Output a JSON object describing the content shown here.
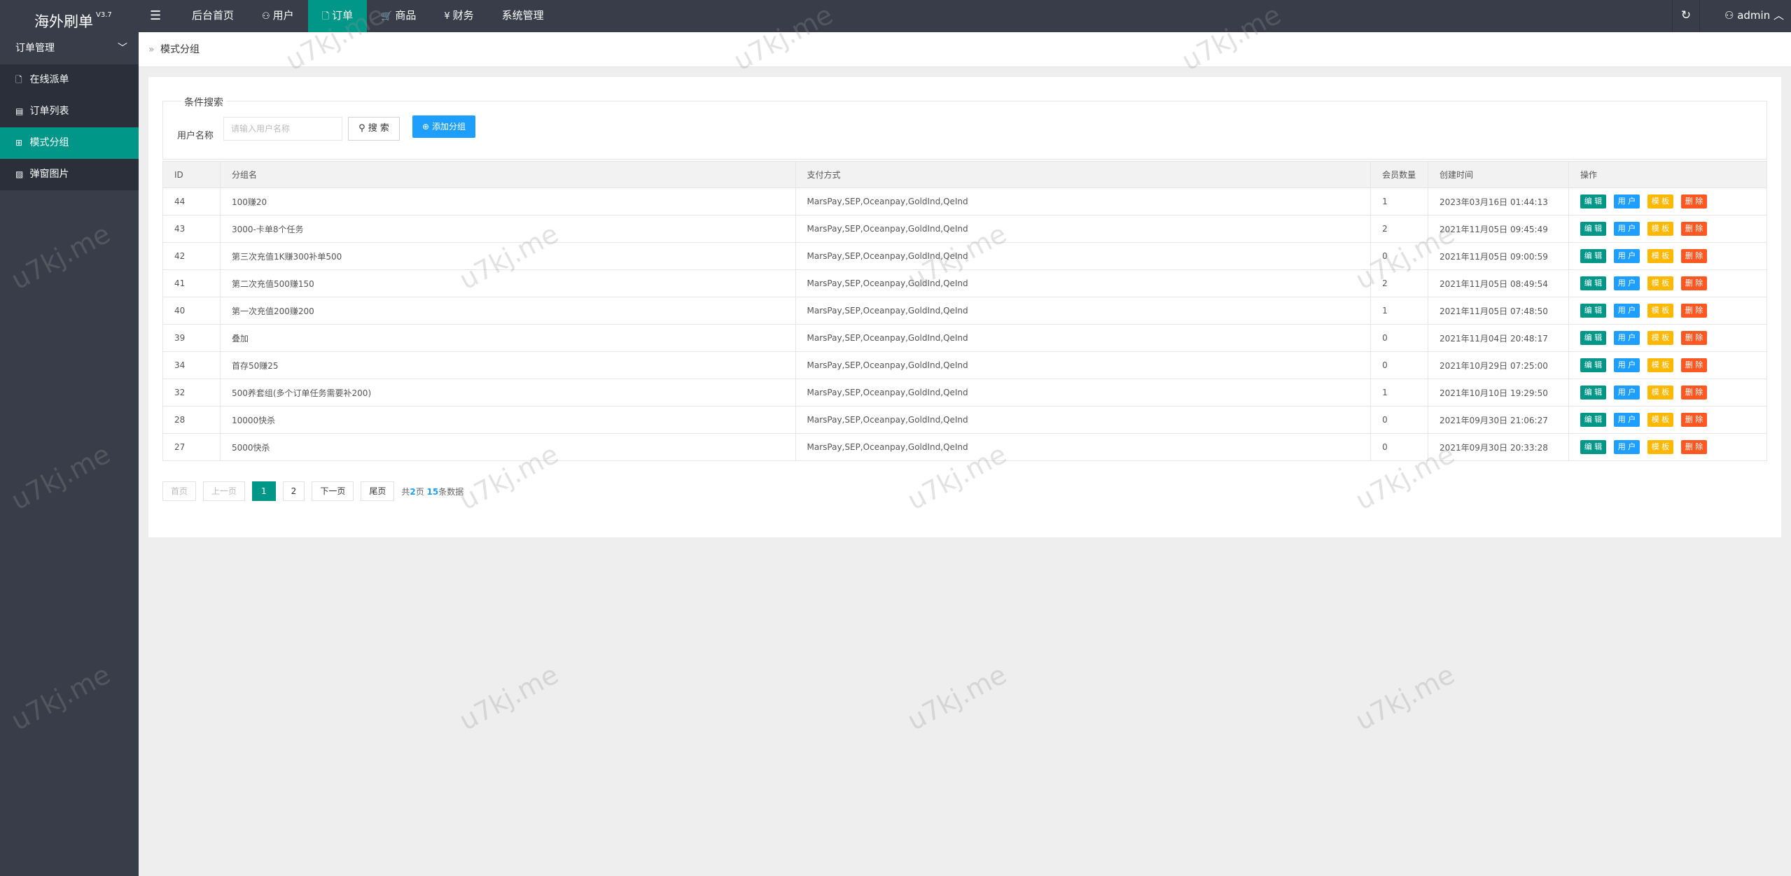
{
  "app": {
    "title": "海外刷单",
    "version": "V3.7"
  },
  "topnav": {
    "menu_icon": "hamburger-icon",
    "items": [
      {
        "label": "后台首页",
        "icon": ""
      },
      {
        "label": "用户",
        "icon": "user-icon"
      },
      {
        "label": "订单",
        "icon": "document-icon",
        "active": true
      },
      {
        "label": "商品",
        "icon": "cart-icon"
      },
      {
        "label": "财务",
        "icon": "yen-icon"
      },
      {
        "label": "系统管理",
        "icon": ""
      }
    ],
    "refresh_icon": "refresh-icon",
    "user": "admin"
  },
  "sidebar": {
    "group": "订单管理",
    "items": [
      {
        "label": "在线派单",
        "icon": "document-icon"
      },
      {
        "label": "订单列表",
        "icon": "list-icon"
      },
      {
        "label": "模式分组",
        "icon": "group-icon",
        "active": true
      },
      {
        "label": "弹窗图片",
        "icon": "image-icon"
      }
    ]
  },
  "breadcrumb": {
    "current": "模式分组"
  },
  "search": {
    "legend": "条件搜索",
    "label": "用户名称",
    "placeholder": "请输入用户名称",
    "search_button": "搜 索",
    "add_button": "添加分组"
  },
  "table": {
    "headers": [
      "ID",
      "分组名",
      "支付方式",
      "会员数量",
      "创建时间",
      "操作"
    ],
    "actions": [
      "编 辑",
      "用 户",
      "模 板",
      "删 除"
    ],
    "rows": [
      {
        "id": "44",
        "name": "100赚20",
        "pay": "MarsPay,SEP,Oceanpay,GoldInd,QeInd",
        "members": "1",
        "created": "2023年03月16日 01:44:13"
      },
      {
        "id": "43",
        "name": "3000-卡单8个任务",
        "pay": "MarsPay,SEP,Oceanpay,GoldInd,QeInd",
        "members": "2",
        "created": "2021年11月05日 09:45:49"
      },
      {
        "id": "42",
        "name": "第三次充值1K赚300补单500",
        "pay": "MarsPay,SEP,Oceanpay,GoldInd,QeInd",
        "members": "0",
        "created": "2021年11月05日 09:00:59"
      },
      {
        "id": "41",
        "name": "第二次充值500赚150",
        "pay": "MarsPay,SEP,Oceanpay,GoldInd,QeInd",
        "members": "2",
        "created": "2021年11月05日 08:49:54"
      },
      {
        "id": "40",
        "name": "第一次充值200赚200",
        "pay": "MarsPay,SEP,Oceanpay,GoldInd,QeInd",
        "members": "1",
        "created": "2021年11月05日 07:48:50"
      },
      {
        "id": "39",
        "name": "叠加",
        "pay": "MarsPay,SEP,Oceanpay,GoldInd,QeInd",
        "members": "0",
        "created": "2021年11月04日 20:48:17"
      },
      {
        "id": "34",
        "name": "首存50赚25",
        "pay": "MarsPay,SEP,Oceanpay,GoldInd,QeInd",
        "members": "0",
        "created": "2021年10月29日 07:25:00"
      },
      {
        "id": "32",
        "name": "500养套组(多个订单任务需要补200)",
        "pay": "MarsPay,SEP,Oceanpay,GoldInd,QeInd",
        "members": "1",
        "created": "2021年10月10日 19:29:50"
      },
      {
        "id": "28",
        "name": "10000快杀",
        "pay": "MarsPay,SEP,Oceanpay,GoldInd,QeInd",
        "members": "0",
        "created": "2021年09月30日 21:06:27"
      },
      {
        "id": "27",
        "name": "5000快杀",
        "pay": "MarsPay,SEP,Oceanpay,GoldInd,QeInd",
        "members": "0",
        "created": "2021年09月30日 20:33:28"
      }
    ]
  },
  "pager": {
    "first": "首页",
    "prev": "上一页",
    "pages": [
      "1",
      "2"
    ],
    "current": "1",
    "next": "下一页",
    "last": "尾页",
    "info_prefix": "共",
    "total_pages": "2",
    "info_mid": "页 ",
    "total_records": "15",
    "info_suffix": "条数据"
  },
  "watermark": "u7kj.me"
}
